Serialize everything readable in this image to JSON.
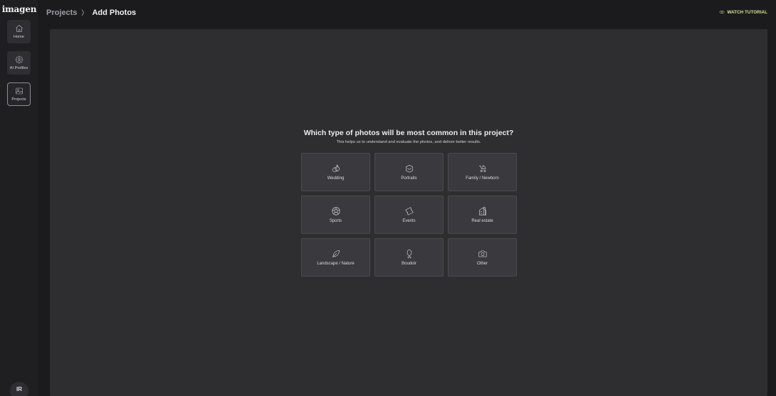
{
  "app": {
    "logo": "imagen"
  },
  "sidebar": {
    "items": [
      {
        "label": "Home",
        "icon": "home-icon"
      },
      {
        "label": "AI Profiles",
        "icon": "ai-profile-icon"
      },
      {
        "label": "Projects",
        "icon": "projects-icon",
        "active": true
      }
    ],
    "avatar": "IR"
  },
  "header": {
    "breadcrumb": {
      "parent": "Projects",
      "separator": "〉",
      "current": "Add Photos"
    },
    "tutorial_label": "WATCH TUTORIAL"
  },
  "main": {
    "question": "Which type of photos will be most common in this project?",
    "subtext": "This helps us to understand and evaluate the photos, and deliver better results.",
    "options": [
      {
        "label": "Wedding",
        "icon": "wedding-rings-icon"
      },
      {
        "label": "Portraits",
        "icon": "portrait-icon"
      },
      {
        "label": "Family / Newborn",
        "icon": "stroller-icon"
      },
      {
        "label": "Sports",
        "icon": "ball-icon"
      },
      {
        "label": "Events",
        "icon": "ticket-icon"
      },
      {
        "label": "Real estate",
        "icon": "building-icon"
      },
      {
        "label": "Landscape / Nature",
        "icon": "leaf-icon"
      },
      {
        "label": "Boudoir",
        "icon": "mirror-icon"
      },
      {
        "label": "Other",
        "icon": "camera-icon"
      }
    ]
  },
  "colors": {
    "background": "#1b1b1d",
    "panel": "#2e2e31",
    "card": "#3a3a3e",
    "accent": "#d8e69a"
  }
}
